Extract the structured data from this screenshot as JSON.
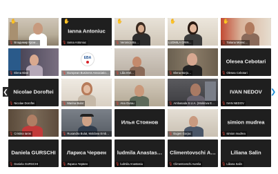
{
  "participants": [
    {
      "label": "Владимир Кром…",
      "avatar_text": "",
      "hand": true
    },
    {
      "label": "Ianna Antoniuc",
      "avatar_text": "Ianna Antoniuc",
      "hand": true
    },
    {
      "label": "Veronica Bo…",
      "avatar_text": "",
      "hand": true
    },
    {
      "label": "LUDMILA GRIN…",
      "avatar_text": "",
      "hand": true
    },
    {
      "label": "Tatiana Monsc…",
      "avatar_text": "",
      "hand": true
    },
    {
      "label": "Elena Bivol",
      "avatar_text": "",
      "hand": false
    },
    {
      "label": "European Business Associatio…",
      "avatar_text": "",
      "hand": false,
      "logo_text": "EBA"
    },
    {
      "label": "Lilia Irtel…",
      "avatar_text": "",
      "hand": false
    },
    {
      "label": "Elena Borjo…",
      "avatar_text": "",
      "hand": false
    },
    {
      "label": "Olesea Cebotari",
      "avatar_text": "Olesea Cebotari",
      "hand": false
    },
    {
      "label": "Nicolae Doroftei",
      "avatar_text": "Nicolae Doroftei",
      "hand": false
    },
    {
      "label": "Marina Bulat",
      "avatar_text": "",
      "hand": false
    },
    {
      "label": "Ana Gurau",
      "avatar_text": "",
      "hand": false
    },
    {
      "label": "Ambasada S.U.A. (Moldova Embassy)",
      "avatar_text": "",
      "hand": false
    },
    {
      "label": "IVAN NEDOV",
      "avatar_text": "IVAN NEDOV",
      "hand": false
    },
    {
      "label": "Cristina Iaros",
      "avatar_text": "",
      "hand": false
    },
    {
      "label": "Ruxandra Bulat, Moldova Embassy…",
      "avatar_text": "",
      "hand": false
    },
    {
      "label": "Илья Стоянов",
      "avatar_text": "Илья Стоянов",
      "hand": false
    },
    {
      "label": "Eugen Gorjac",
      "avatar_text": "",
      "hand": false
    },
    {
      "label": "simion mudrea",
      "avatar_text": "simion mudrea",
      "hand": false
    },
    {
      "label": "Daniela GURSCHI",
      "avatar_text": "Daniela GURSCHI",
      "hand": false
    },
    {
      "label": "Лариса Червен",
      "avatar_text": "Лариса Червен",
      "hand": false
    },
    {
      "label": "ludmila Anastasiu",
      "avatar_text": "ludmila Anastas…",
      "hand": false
    },
    {
      "label": "Climentovschi Aurelia",
      "avatar_text": "Climentovschi A…",
      "hand": false
    },
    {
      "label": "Liliana Salin",
      "avatar_text": "Liliana Salin",
      "hand": false
    }
  ],
  "icons": {
    "hand": "✋",
    "mic": "🎙",
    "prev": "❮",
    "next": "❯"
  },
  "colors": {
    "tile_bg": "#1f1f1f",
    "active_border": "#c9e23c",
    "muted_mic": "#e8463a",
    "next_arrow": "#1a8ad4"
  }
}
